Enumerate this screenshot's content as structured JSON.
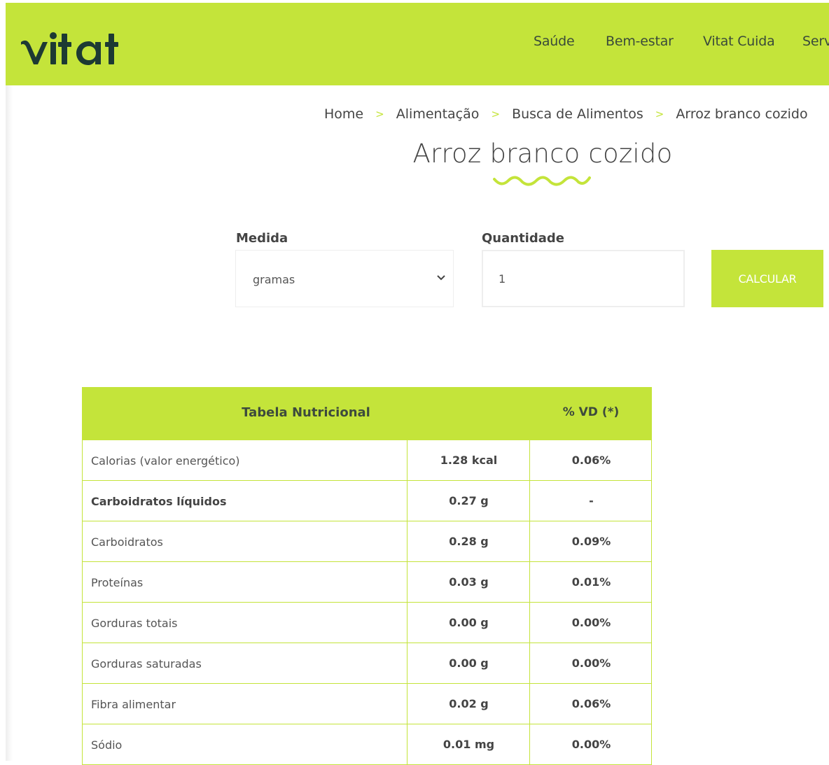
{
  "brand": {
    "logo_text": "vitat",
    "accent_color": "#c4e43a"
  },
  "nav": {
    "items": [
      "Saúde",
      "Bem-estar",
      "Vitat Cuida",
      "Serv"
    ]
  },
  "breadcrumb": [
    "Home",
    "Alimentação",
    "Busca de Alimentos",
    "Arroz branco cozido"
  ],
  "breadcrumb_separator": ">",
  "page_title": "Arroz branco cozido",
  "form": {
    "medida_label": "Medida",
    "medida_value": "gramas",
    "quantidade_label": "Quantidade",
    "quantidade_value": "1",
    "calc_label": "CALCULAR"
  },
  "table": {
    "header_title": "Tabela Nutricional",
    "header_vd": "% VD (*)",
    "rows": [
      {
        "name": "Calorias (valor energético)",
        "amount": "1.28 kcal",
        "vd": "0.06%",
        "bold": false
      },
      {
        "name": "Carboidratos líquidos",
        "amount": "0.27 g",
        "vd": "-",
        "bold": true
      },
      {
        "name": "Carboidratos",
        "amount": "0.28 g",
        "vd": "0.09%",
        "bold": false
      },
      {
        "name": "Proteínas",
        "amount": "0.03 g",
        "vd": "0.01%",
        "bold": false
      },
      {
        "name": "Gorduras totais",
        "amount": "0.00 g",
        "vd": "0.00%",
        "bold": false
      },
      {
        "name": "Gorduras saturadas",
        "amount": "0.00 g",
        "vd": "0.00%",
        "bold": false
      },
      {
        "name": "Fibra alimentar",
        "amount": "0.02 g",
        "vd": "0.06%",
        "bold": false
      },
      {
        "name": "Sódio",
        "amount": "0.01 mg",
        "vd": "0.00%",
        "bold": false
      }
    ]
  }
}
